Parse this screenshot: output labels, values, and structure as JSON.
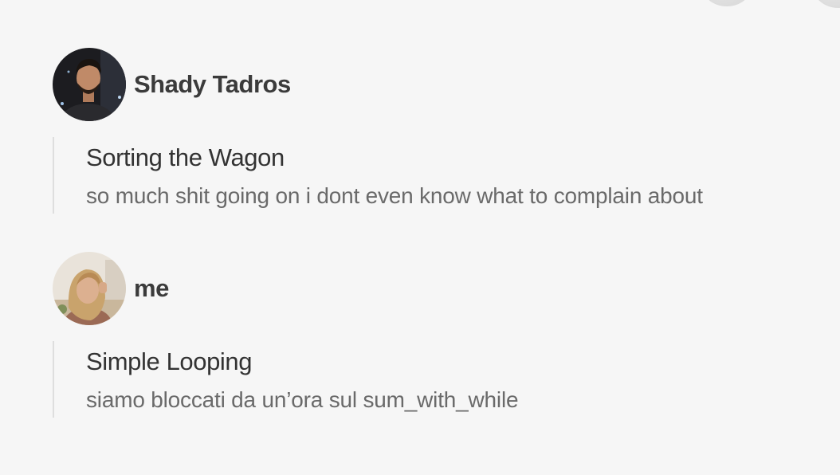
{
  "posts": [
    {
      "author": "Shady Tadros",
      "avatar_icon": "user-avatar-photo",
      "title": "Sorting the Wagon",
      "text": "so much shit going on i dont even know what to complain about"
    },
    {
      "author": "me",
      "avatar_icon": "user-avatar-photo",
      "title": "Simple Looping",
      "text": "siamo bloccati da un’ora sul sum_with_while"
    }
  ]
}
